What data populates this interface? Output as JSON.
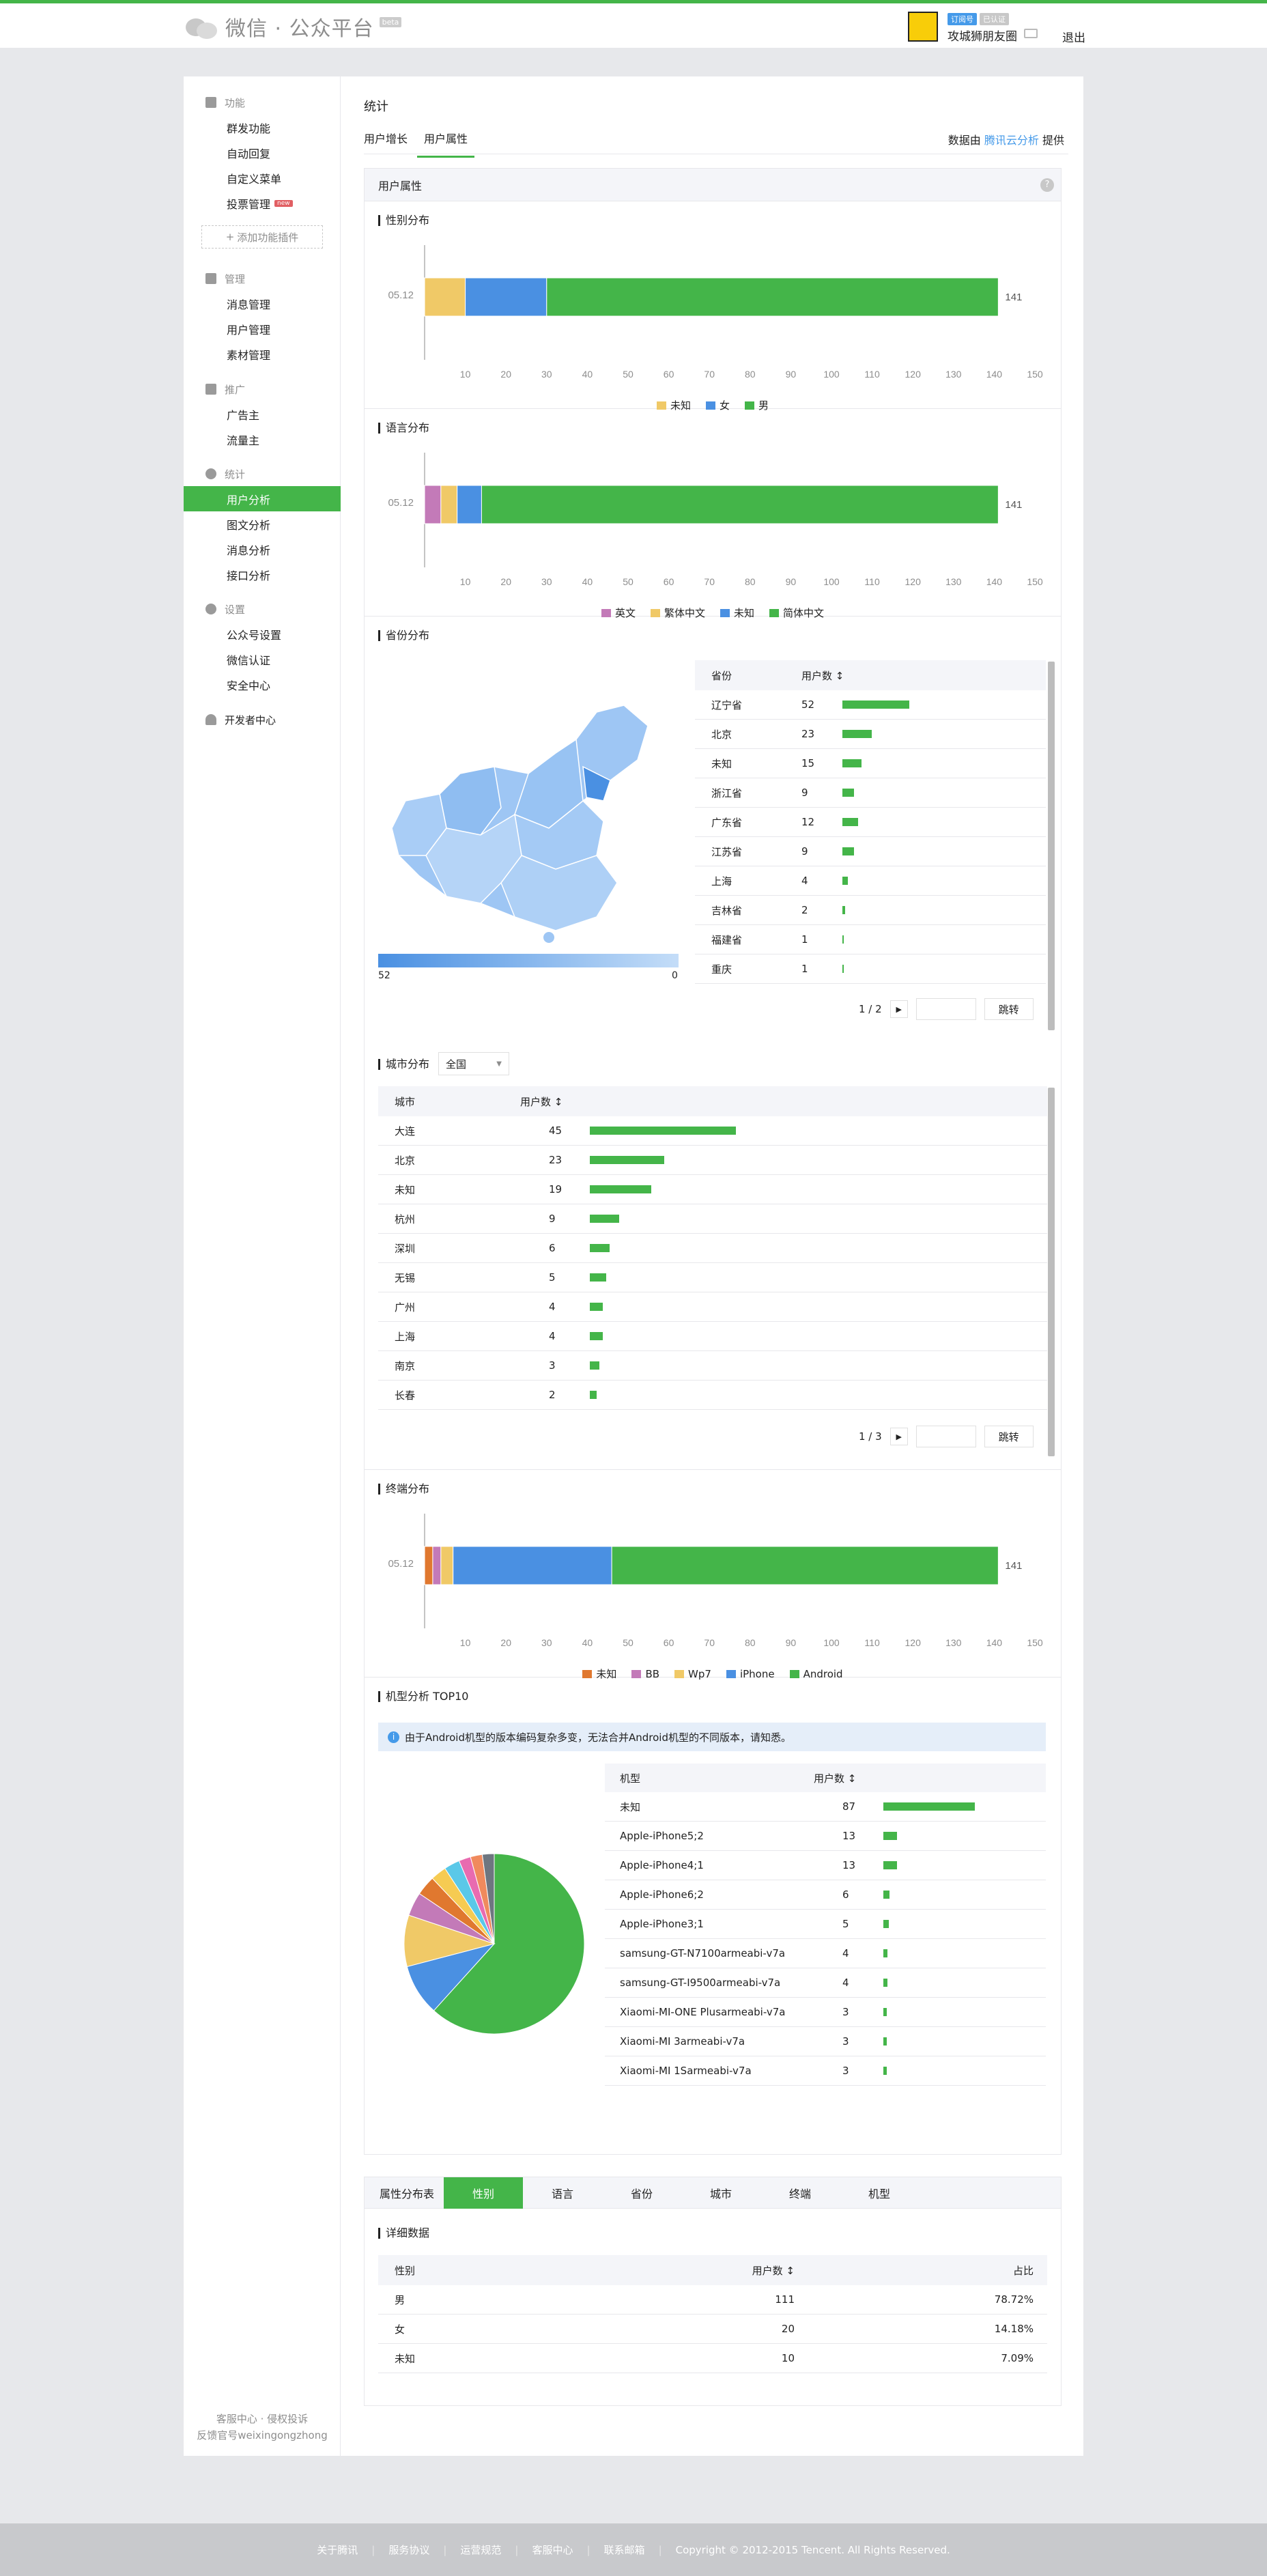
{
  "header": {
    "logo_text": "微信 · 公众平台",
    "logo_badge": "beta",
    "acct_tags": [
      "订阅号",
      "已认证"
    ],
    "acct_name": "攻城狮朋友圈",
    "logout": "退出"
  },
  "sidebar": {
    "groups": [
      {
        "cat": "功能",
        "items": [
          "群发功能",
          "自动回复",
          "自定义菜单",
          "投票管理"
        ],
        "new_badge": "new",
        "add_plugin": "添加功能插件"
      },
      {
        "cat": "管理",
        "items": [
          "消息管理",
          "用户管理",
          "素材管理"
        ]
      },
      {
        "cat": "推广",
        "items": [
          "广告主",
          "流量主"
        ]
      },
      {
        "cat": "统计",
        "items": [
          "用户分析",
          "图文分析",
          "消息分析",
          "接口分析"
        ],
        "active": "用户分析"
      },
      {
        "cat": "设置",
        "items": [
          "公众号设置",
          "微信认证",
          "安全中心"
        ]
      },
      {
        "cat": "开发者中心",
        "items": []
      }
    ],
    "footer": [
      "客服中心 · 侵权投诉",
      "反馈官号weixingongzhong"
    ]
  },
  "main": {
    "title": "统计",
    "tabs": [
      "用户增长",
      "用户属性"
    ],
    "active_tab": "用户属性",
    "provider_prefix": "数据由",
    "provider_link": "腾讯云分析",
    "provider_suffix": "提供",
    "panel_title": "用户属性",
    "help": "?"
  },
  "sections": {
    "gender": {
      "title": "性别分布"
    },
    "language": {
      "title": "语言分布"
    },
    "province": {
      "title": "省份分布",
      "legend_max": "52",
      "legend_min": "0",
      "col1": "省份",
      "col2": "用户数 ↕",
      "rows": [
        [
          "辽宁省",
          52
        ],
        [
          "北京",
          23
        ],
        [
          "未知",
          15
        ],
        [
          "浙江省",
          9
        ],
        [
          "广东省",
          12
        ],
        [
          "江苏省",
          9
        ],
        [
          "上海",
          4
        ],
        [
          "吉林省",
          2
        ],
        [
          "福建省",
          1
        ],
        [
          "重庆",
          1
        ]
      ],
      "page": "1 / 2",
      "go": "跳转"
    },
    "city": {
      "title": "城市分布",
      "filter": "全国",
      "col1": "城市",
      "col2": "用户数 ↕",
      "rows": [
        [
          "大连",
          45
        ],
        [
          "北京",
          23
        ],
        [
          "未知",
          19
        ],
        [
          "杭州",
          9
        ],
        [
          "深圳",
          6
        ],
        [
          "无锡",
          5
        ],
        [
          "广州",
          4
        ],
        [
          "上海",
          4
        ],
        [
          "南京",
          3
        ],
        [
          "长春",
          2
        ]
      ],
      "page": "1 / 3",
      "go": "跳转"
    },
    "terminal": {
      "title": "终端分布"
    },
    "model": {
      "title": "机型分析 TOP10",
      "notice": "由于Android机型的版本编码复杂多变，无法合并Android机型的不同版本，请知悉。",
      "col1": "机型",
      "col2": "用户数 ↕",
      "rows": [
        [
          "未知",
          87
        ],
        [
          "Apple-iPhone5;2",
          13
        ],
        [
          "Apple-iPhone4;1",
          13
        ],
        [
          "Apple-iPhone6;2",
          6
        ],
        [
          "Apple-iPhone3;1",
          5
        ],
        [
          "samsung-GT-N7100armeabi-v7a",
          4
        ],
        [
          "samsung-GT-I9500armeabi-v7a",
          4
        ],
        [
          "Xiaomi-MI-ONE Plusarmeabi-v7a",
          3
        ],
        [
          "Xiaomi-MI 3armeabi-v7a",
          3
        ],
        [
          "Xiaomi-MI 1Sarmeabi-v7a",
          3
        ]
      ]
    },
    "dist": {
      "label": "属性分布表",
      "tabs": [
        "性别",
        "语言",
        "省份",
        "城市",
        "终端",
        "机型"
      ],
      "active": "性别",
      "title": "详细数据",
      "cols": [
        "性别",
        "用户数 ↕",
        "占比"
      ],
      "rows": [
        [
          "男",
          "111",
          "78.72%"
        ],
        [
          "女",
          "20",
          "14.18%"
        ],
        [
          "未知",
          "10",
          "7.09%"
        ]
      ]
    }
  },
  "chart_data": [
    {
      "type": "bar",
      "orientation": "horizontal",
      "stacked": true,
      "title": "性别分布",
      "categories": [
        "05.12"
      ],
      "series": [
        {
          "name": "未知",
          "values": [
            10
          ],
          "color": "#f0c967"
        },
        {
          "name": "女",
          "values": [
            20
          ],
          "color": "#4a90e2"
        },
        {
          "name": "男",
          "values": [
            111
          ],
          "color": "#44b549"
        }
      ],
      "total_label": "141",
      "xlim": [
        0,
        150
      ],
      "xticks": [
        10,
        20,
        30,
        40,
        50,
        60,
        70,
        80,
        90,
        100,
        110,
        120,
        130,
        140,
        150
      ],
      "legend": "bottom"
    },
    {
      "type": "bar",
      "orientation": "horizontal",
      "stacked": true,
      "title": "语言分布",
      "categories": [
        "05.12"
      ],
      "series": [
        {
          "name": "英文",
          "values": [
            4
          ],
          "color": "#c37ab8"
        },
        {
          "name": "繁体中文",
          "values": [
            4
          ],
          "color": "#f0c967"
        },
        {
          "name": "未知",
          "values": [
            6
          ],
          "color": "#4a90e2"
        },
        {
          "name": "简体中文",
          "values": [
            127
          ],
          "color": "#44b549"
        }
      ],
      "total_label": "141",
      "xlim": [
        0,
        150
      ],
      "xticks": [
        10,
        20,
        30,
        40,
        50,
        60,
        70,
        80,
        90,
        100,
        110,
        120,
        130,
        140,
        150
      ],
      "legend": "bottom"
    },
    {
      "type": "bar",
      "orientation": "horizontal",
      "stacked": true,
      "title": "终端分布",
      "categories": [
        "05.12"
      ],
      "series": [
        {
          "name": "未知",
          "values": [
            2
          ],
          "color": "#e0782f"
        },
        {
          "name": "BB",
          "values": [
            2
          ],
          "color": "#c37ab8"
        },
        {
          "name": "Wp7",
          "values": [
            3
          ],
          "color": "#f0c967"
        },
        {
          "name": "iPhone",
          "values": [
            39
          ],
          "color": "#4a90e2"
        },
        {
          "name": "Android",
          "values": [
            95
          ],
          "color": "#44b549"
        }
      ],
      "total_label": "141",
      "xlim": [
        0,
        150
      ],
      "xticks": [
        10,
        20,
        30,
        40,
        50,
        60,
        70,
        80,
        90,
        100,
        110,
        120,
        130,
        140,
        150
      ],
      "legend": "bottom"
    },
    {
      "type": "pie",
      "title": "机型分析 TOP10",
      "values": [
        87,
        13,
        13,
        6,
        5,
        4,
        4,
        3,
        3,
        3
      ],
      "colors": [
        "#44b549",
        "#4a90e2",
        "#f0c967",
        "#c37ab8",
        "#e0782f",
        "#f6cb52",
        "#5ac8e8",
        "#e86bb0",
        "#f08a5d",
        "#6e7680"
      ]
    }
  ],
  "footer": {
    "links": [
      "关于腾讯",
      "服务协议",
      "运营规范",
      "客服中心",
      "联系邮箱"
    ],
    "copyright": "Copyright © 2012-2015 Tencent. All Rights Reserved."
  }
}
